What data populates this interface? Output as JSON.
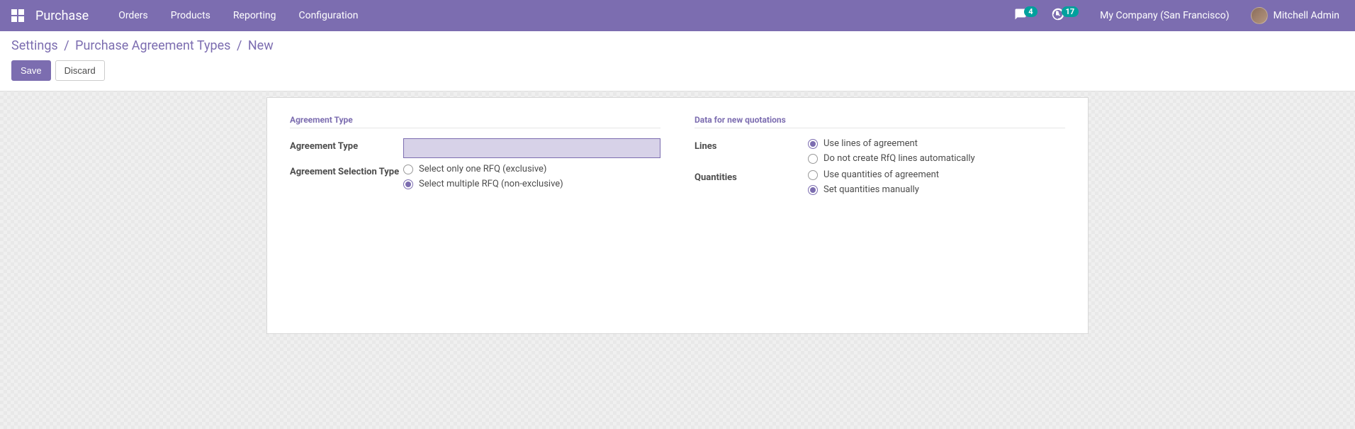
{
  "navbar": {
    "app_title": "Purchase",
    "menu": {
      "orders": "Orders",
      "products": "Products",
      "reporting": "Reporting",
      "configuration": "Configuration"
    },
    "messages_badge": "4",
    "activities_badge": "17",
    "company": "My Company (San Francisco)",
    "user": "Mitchell Admin"
  },
  "breadcrumb": {
    "settings": "Settings",
    "agreement_types": "Purchase Agreement Types",
    "current": "New"
  },
  "actions": {
    "save": "Save",
    "discard": "Discard"
  },
  "form": {
    "left": {
      "section_title": "Agreement Type",
      "agreement_type_label": "Agreement Type",
      "agreement_type_value": "",
      "selection_type_label": "Agreement Selection Type",
      "selection_options": {
        "exclusive": "Select only one RFQ (exclusive)",
        "non_exclusive": "Select multiple RFQ (non-exclusive)"
      },
      "selection_selected": "non_exclusive"
    },
    "right": {
      "section_title": "Data for new quotations",
      "lines_label": "Lines",
      "lines_options": {
        "use_lines": "Use lines of agreement",
        "no_lines": "Do not create RfQ lines automatically"
      },
      "lines_selected": "use_lines",
      "quantities_label": "Quantities",
      "quantities_options": {
        "use_qty": "Use quantities of agreement",
        "manual_qty": "Set quantities manually"
      },
      "quantities_selected": "manual_qty"
    }
  }
}
